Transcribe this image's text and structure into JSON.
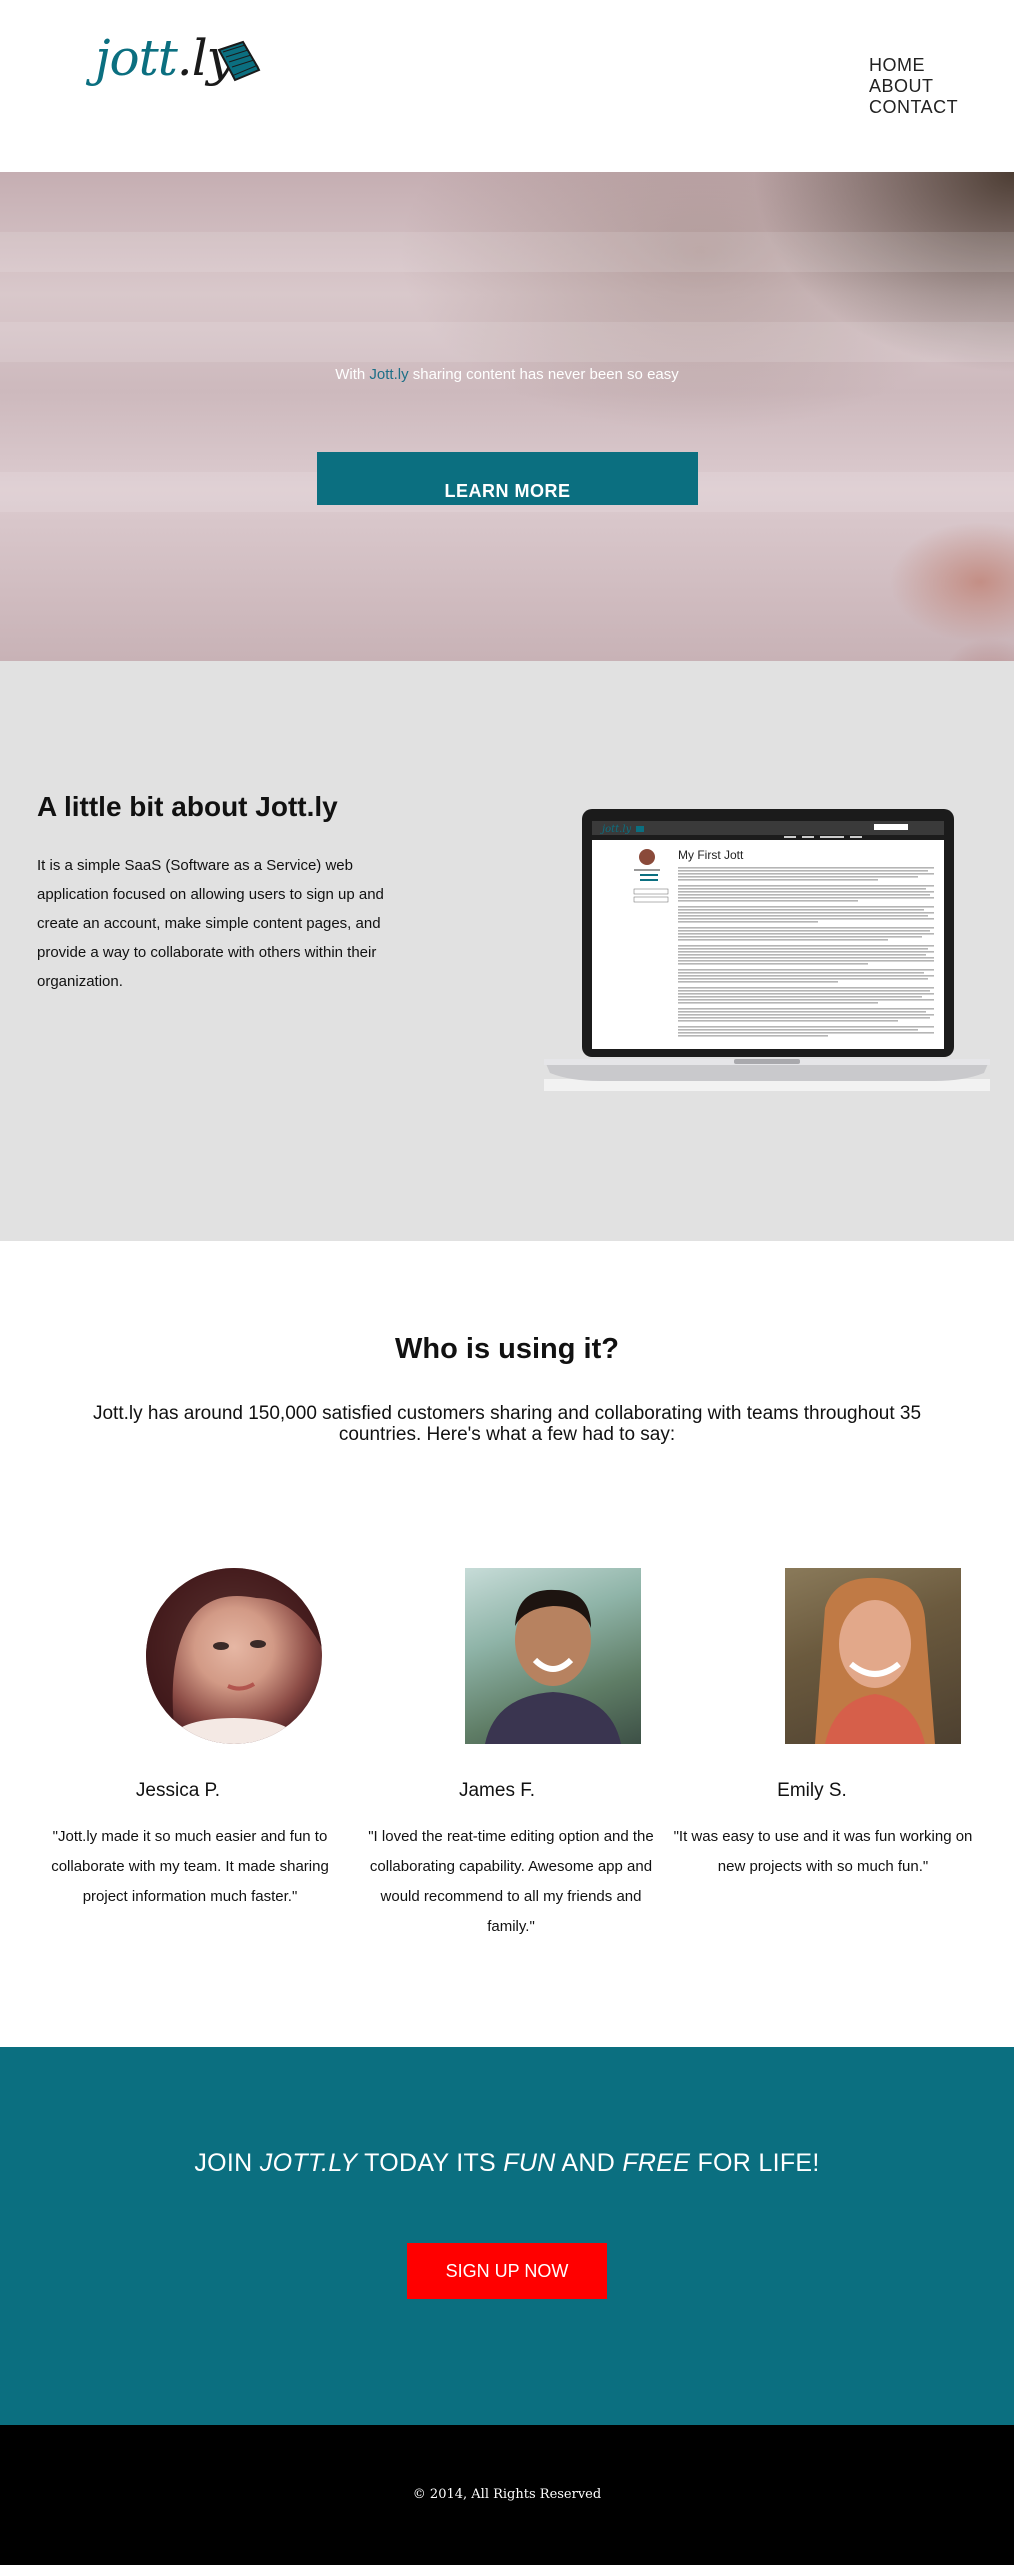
{
  "colors": {
    "brand_teal": "#0b6f80",
    "cta_red": "#ff0000",
    "about_bg": "#e1e1e1",
    "footer_bg": "#000000"
  },
  "header": {
    "logo": {
      "part1": "jott",
      "part2": ".ly"
    },
    "nav": [
      "HOME",
      "ABOUT",
      "CONTACT"
    ]
  },
  "hero": {
    "tagline_pre": "With ",
    "tagline_brand": "Jott.ly",
    "tagline_post": " sharing content has never been so easy",
    "button": "LEARN MORE"
  },
  "about": {
    "title": "A little bit about Jott.ly",
    "body": "It is a simple SaaS (Software as a Service) web application focused on allowing users to sign up and create an account, make simple content pages, and provide a way to collaborate with others within their organization.",
    "screenshot": {
      "page_title": "My First Jott"
    }
  },
  "who": {
    "title": "Who is using it?",
    "body": "Jott.ly has around 150,000 satisfied customers sharing and collaborating with teams throughout 35 countries. Here's what a few had to say:",
    "testimonials": [
      {
        "name": "Jessica P.",
        "quote": "\"Jott.ly made it so much easier and fun to collaborate with my team. It made sharing project information much faster.\""
      },
      {
        "name": "James F.",
        "quote": "\"I loved the reat-time editing option and the collaborating capability. Awesome app and would recommend to all my friends and family.\""
      },
      {
        "name": "Emily S.",
        "quote": "\"It was easy to use and it was fun working on new projects with so much fun.\""
      }
    ]
  },
  "cta": {
    "p1": "JOIN ",
    "p2": "JOTT.LY",
    "p3": " TODAY ITS ",
    "p4": "FUN",
    "p5": " AND ",
    "p6": "FREE",
    "p7": " FOR LIFE!",
    "button": "SIGN UP NOW"
  },
  "footer": {
    "text": "© 2014, All Rights Reserved"
  }
}
